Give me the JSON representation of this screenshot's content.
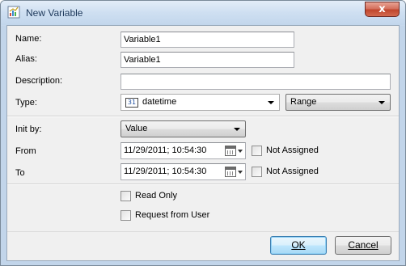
{
  "window": {
    "title": "New Variable",
    "close_glyph": "x"
  },
  "form": {
    "name_label": "Name:",
    "name_value": "Variable1",
    "alias_label": "Alias:",
    "alias_value": "Variable1",
    "description_label": "Description:",
    "description_value": "",
    "type_label": "Type:",
    "type_value": "datetime",
    "type_icon": "datetime-icon",
    "range_value": "Range",
    "init_label": "Init by:",
    "init_value": "Value",
    "from_label": "From",
    "from_value": "11/29/2011; 10:54:30",
    "from_not_assigned": "Not Assigned",
    "to_label": "To",
    "to_value": "11/29/2011; 10:54:30",
    "to_not_assigned": "Not Assigned",
    "read_only_label": "Read Only",
    "request_from_user_label": "Request from User"
  },
  "buttons": {
    "ok_label": "OK",
    "cancel_label": "Cancel"
  },
  "colors": {
    "title_text": "#1e395b",
    "close_button": "#c0462d",
    "default_button_border": "#3c7fb1"
  }
}
